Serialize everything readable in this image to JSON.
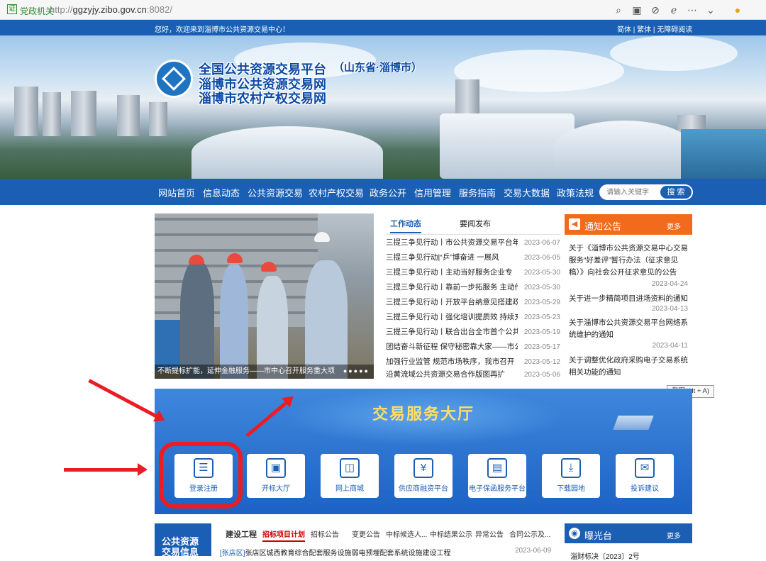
{
  "browser": {
    "badge": "党政机关",
    "url_host": "ggzyjy.zibo.gov.cn",
    "url_port": ":8082/",
    "url_scheme": "http://"
  },
  "topbar": {
    "welcome": "您好，欢迎来到淄博市公共资源交易中心！",
    "links": "简体 | 繁体 | 无障碍阅读"
  },
  "banner": {
    "line1": "全国公共资源交易平台",
    "province": "（山东省·淄博市）",
    "line2": "淄博市公共资源交易网",
    "line3": "淄博市农村产权交易网"
  },
  "nav": {
    "items": [
      "网站首页",
      "信息动态",
      "公共资源交易",
      "农村产权交易",
      "政务公开",
      "信用管理",
      "服务指南",
      "交易大数据",
      "政策法规"
    ],
    "search_placeholder": "请输入关键字",
    "search_button": "搜 索"
  },
  "photo": {
    "caption": "不断提标扩能，延伸金融服务——市中心召开服务重大项"
  },
  "news": {
    "tabs": [
      "工作动态",
      "要闻发布"
    ],
    "items": [
      {
        "title": "三提三争见行动丨市公共资源交易平台年",
        "date": "2023-06-07"
      },
      {
        "title": "三提三争见行动|“乒”博奋进 一展风",
        "date": "2023-06-05"
      },
      {
        "title": "三提三争见行动丨主动当好服务企业专",
        "date": "2023-05-30"
      },
      {
        "title": "三提三争见行动丨靠前一步拓服务 主动作",
        "date": "2023-05-30"
      },
      {
        "title": "三提三争见行动丨开放平台纳意见搭建政",
        "date": "2023-05-29"
      },
      {
        "title": "三提三争见行动丨强化培训提质效 持续充",
        "date": "2023-05-23"
      },
      {
        "title": "三提三争见行动丨联合出台全市首个公共",
        "date": "2023-05-19"
      },
      {
        "title": "团结奋斗新征程 保守秘密靠大家——市公",
        "date": "2023-05-17"
      },
      {
        "title": "加强行业监管 规范市场秩序，我市召开",
        "date": "2023-05-12"
      },
      {
        "title": "沿黄流域公共资源交易合作版图再扩",
        "date": "2023-05-06"
      }
    ]
  },
  "notice": {
    "title": "通知公告",
    "more": "更多",
    "items": [
      {
        "title": "关于《淄博市公共资源交易中心交易服务“好差评”暂行办法（征求意见稿）》向社会公开征求意见的公告",
        "date": "2023-04-24"
      },
      {
        "title": "关于进一步精简项目进场资料的通知",
        "date": "2023-04-13"
      },
      {
        "title": "关于淄博市公共资源交易平台网络系统维护的通知",
        "date": "2023-04-11"
      },
      {
        "title": "关于调整优化政府采购电子交易系统相关功能的通知",
        "date": ""
      }
    ]
  },
  "tooltip": "截图(Alt + A)",
  "hall": {
    "title": "交易服务大厅",
    "cards": [
      {
        "label": "登录注册",
        "icon": "login-register-icon",
        "glyph": "☰"
      },
      {
        "label": "开标大厅",
        "icon": "bid-hall-icon",
        "glyph": "▣"
      },
      {
        "label": "网上商城",
        "icon": "shopping-bag-icon",
        "glyph": "◫"
      },
      {
        "label": "供应商融资平台",
        "icon": "yuan-coin-icon",
        "glyph": "¥"
      },
      {
        "label": "电子保函服务平台",
        "icon": "guarantee-doc-icon",
        "glyph": "▤"
      },
      {
        "label": "下载园地",
        "icon": "download-icon",
        "glyph": "⤓"
      },
      {
        "label": "投诉建议",
        "icon": "complaint-icon",
        "glyph": "✉"
      }
    ]
  },
  "bottom": {
    "side_title_1": "公共资源",
    "side_title_2": "交易信息",
    "category": "建设工程",
    "tabs": [
      "招标项目计划",
      "招标公告",
      "变更公告",
      "中标候选人...",
      "中标结果公示",
      "异常公告",
      "合同公示及..."
    ],
    "first_tag": "[张店区]",
    "first_title": "张店区城西教育综合配套服务设施弱电预埋配套系统设施建设工程",
    "first_date": "2023-06-09"
  },
  "expose": {
    "title": "曝光台",
    "more": "更多",
    "first": "淄财标决〔2023〕2号"
  },
  "colors": {
    "primary": "#1a5fb4",
    "accent": "#f26b1d",
    "highlight": "#ec1c24",
    "hall_title": "#ffde66"
  }
}
